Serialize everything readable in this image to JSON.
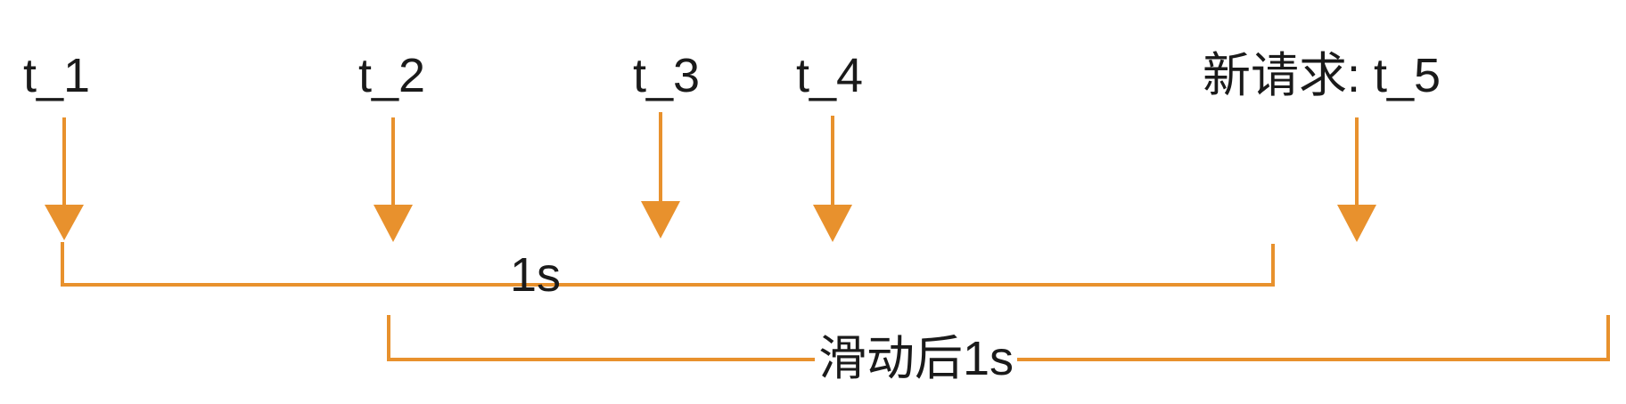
{
  "colors": {
    "accent": "#E8912D",
    "text": "#1a1a1a"
  },
  "timestamps": [
    {
      "label": "t_1"
    },
    {
      "label": "t_2"
    },
    {
      "label": "t_3"
    },
    {
      "label": "t_4"
    },
    {
      "label": "新请求: t_5"
    }
  ],
  "windows": [
    {
      "label": "1s"
    },
    {
      "label": "滑动后1s"
    }
  ]
}
